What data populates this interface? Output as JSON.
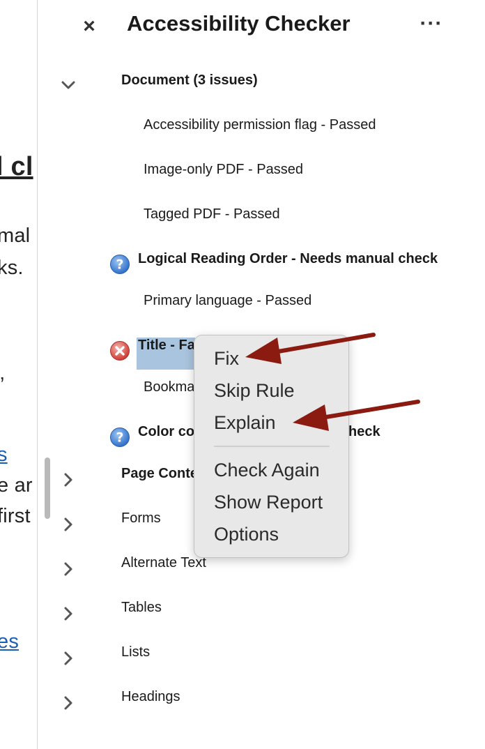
{
  "document": {
    "heading_fragment": "l cl",
    "line1": "mal",
    "line2": "ks.",
    "quote": "”",
    "link1": "s",
    "line3": "e ar",
    "line4": "first",
    "link2": "es"
  },
  "panel": {
    "title": "Accessibility Checker",
    "close_glyph": "×",
    "more_glyph": "···"
  },
  "tree": {
    "document_group": "Document (3 issues)",
    "items": {
      "permission_flag": "Accessibility permission flag - Passed",
      "image_only": "Image-only PDF - Passed",
      "tagged_pdf": "Tagged PDF - Passed",
      "reading_order": "Logical Reading Order - Needs manual check",
      "primary_language": "Primary language - Passed",
      "title": "Title - Fa",
      "bookmarks": "Bookma",
      "color_contrast_left": "Color con",
      "color_contrast_right": "heck"
    },
    "groups": {
      "page_content": "Page Conte",
      "forms": "Forms",
      "alternate_text": "Alternate Text",
      "tables": "Tables",
      "lists": "Lists",
      "headings": "Headings"
    }
  },
  "context_menu": {
    "fix": "Fix",
    "skip_rule": "Skip Rule",
    "explain": "Explain",
    "check_again": "Check Again",
    "show_report": "Show Report",
    "options": "Options"
  },
  "icons": {
    "help": "question-icon",
    "failed": "error-x-icon",
    "chevron_down": "chevron-down-icon",
    "chevron_right": "chevron-right-icon"
  },
  "colors": {
    "selection": "#a9c4df",
    "annotation_arrow": "#8b1a10",
    "help_blue": "#3d7fd6",
    "error_red": "#d9514a"
  }
}
